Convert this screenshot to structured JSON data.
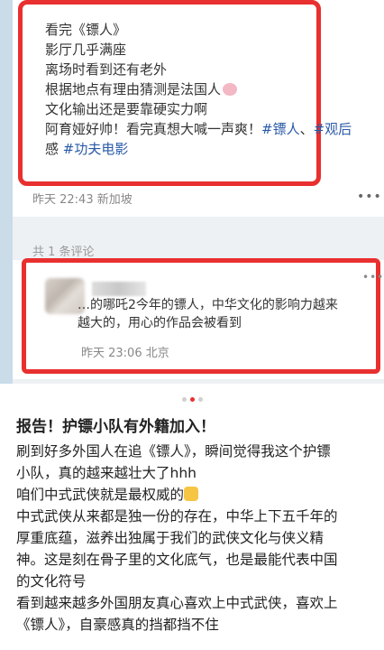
{
  "post": {
    "lines": [
      "看完《镖人》",
      "影厅几乎满座",
      "离场时看到还有老外",
      "根据地点有理由猜测是法国人",
      "文化输出还是要靠硬实力啊",
      "阿育娅好帅！看完真想大喊一声爽！",
      "感"
    ],
    "tag_biao": "#镖人",
    "tag_guanhou": "#观后",
    "tag_kungfu": "#功夫电影",
    "meta": "昨天 22:43 新加坡",
    "pig_emoji": "pig-face-emoji"
  },
  "comment_count": "共 1 条评论",
  "comment": {
    "text_line1": "…的哪吒2今年的镖人，中华文化的影响力越来",
    "text_line2": "越大的，用心的作品会被看到",
    "meta": "昨天 23:06 北京"
  },
  "pager": {
    "count": 3,
    "active": 1
  },
  "article": {
    "title": "报告！护镖小队有外籍加入！",
    "lines": [
      "刷到好多外国人在追《镖人》，瞬间觉得我这个护镖",
      "小队，真的越来越壮大了hhh",
      "咱们中式武侠就是最权威的",
      "中式武侠从来都是独一份的存在，中华上下五千年的",
      "厚重底蕴，滋养出独属于我们的武侠文化与侠义精",
      "神。这是刻在骨子里的文化底气，也是最能代表中国",
      "的文化符号",
      "看到越来越多外国朋友真心喜欢上中式武侠，喜欢上",
      "《镖人》，自豪感真的挡都挡不住"
    ],
    "fist_emoji": "fist-emoji"
  },
  "colors": {
    "highlight": "#e8302f",
    "tag": "#2a5aa8"
  }
}
